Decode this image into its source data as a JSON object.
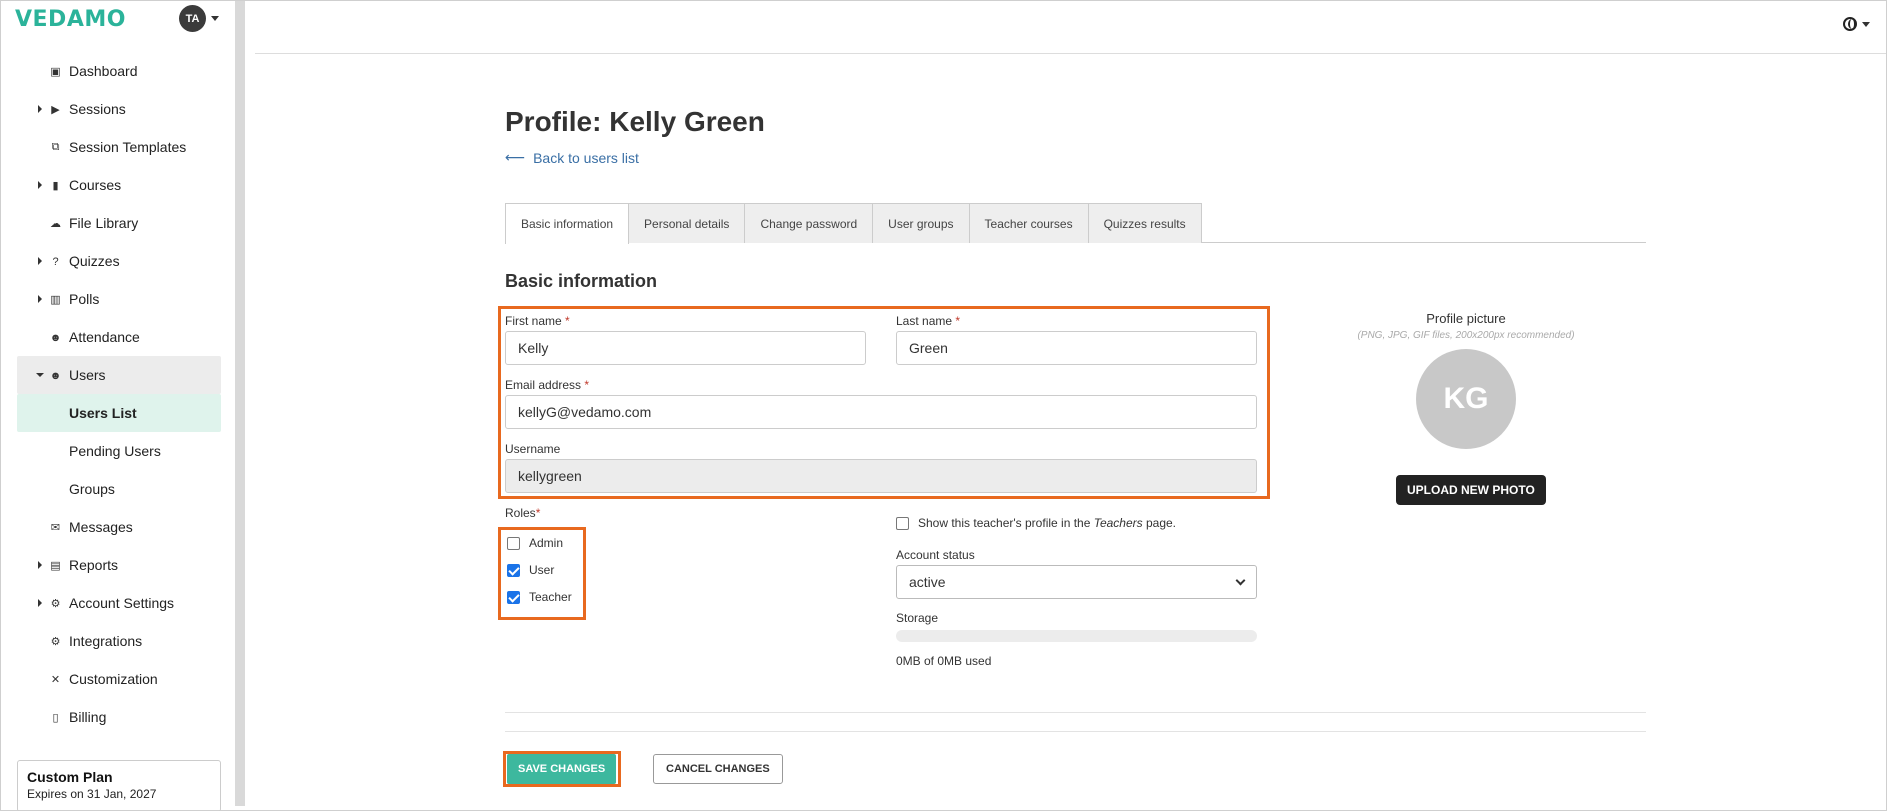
{
  "app": {
    "logo": "VEDAMO",
    "user_initials": "TA"
  },
  "sidebar": {
    "items": [
      {
        "label": "Dashboard"
      },
      {
        "label": "Sessions"
      },
      {
        "label": "Session Templates"
      },
      {
        "label": "Courses"
      },
      {
        "label": "File Library"
      },
      {
        "label": "Quizzes"
      },
      {
        "label": "Polls"
      },
      {
        "label": "Attendance"
      },
      {
        "label": "Users"
      },
      {
        "label": "Users List"
      },
      {
        "label": "Pending Users"
      },
      {
        "label": "Groups"
      },
      {
        "label": "Messages"
      },
      {
        "label": "Reports"
      },
      {
        "label": "Account Settings"
      },
      {
        "label": "Integrations"
      },
      {
        "label": "Customization"
      },
      {
        "label": "Billing"
      }
    ],
    "plan": {
      "name": "Custom Plan",
      "expires": "Expires on 31 Jan, 2027"
    }
  },
  "page": {
    "title": "Profile: Kelly Green",
    "back_link": "Back to users list",
    "tabs": [
      {
        "label": "Basic information"
      },
      {
        "label": "Personal details"
      },
      {
        "label": "Change password"
      },
      {
        "label": "User groups"
      },
      {
        "label": "Teacher courses"
      },
      {
        "label": "Quizzes results"
      }
    ],
    "section_title": "Basic information"
  },
  "form": {
    "first_name": {
      "label": "First name",
      "value": "Kelly"
    },
    "last_name": {
      "label": "Last name",
      "value": "Green"
    },
    "email": {
      "label": "Email address",
      "value": "kellyG@vedamo.com"
    },
    "username": {
      "label": "Username",
      "value": "kellygreen"
    },
    "required_mark": "*",
    "roles": {
      "label": "Roles",
      "options": [
        {
          "label": "Admin",
          "checked": false
        },
        {
          "label": "User",
          "checked": true
        },
        {
          "label": "Teacher",
          "checked": true
        }
      ]
    },
    "show_profile": {
      "label_before": "Show this teacher's profile in the ",
      "label_em": "Teachers",
      "label_after": " page.",
      "checked": false
    },
    "account_status": {
      "label": "Account status",
      "value": "active"
    },
    "storage": {
      "label": "Storage",
      "used_text": "0MB of 0MB used",
      "fraction": 0
    }
  },
  "profile_picture": {
    "label": "Profile picture",
    "hint": "(PNG, JPG, GIF files, 200x200px recommended)",
    "initials": "KG",
    "upload_label": "UPLOAD NEW PHOTO"
  },
  "actions": {
    "save_label": "SAVE CHANGES",
    "cancel_label": "CANCEL CHANGES"
  },
  "colors": {
    "brand": "#2bb39a",
    "highlight": "#e8691f",
    "save": "#3db89e"
  }
}
